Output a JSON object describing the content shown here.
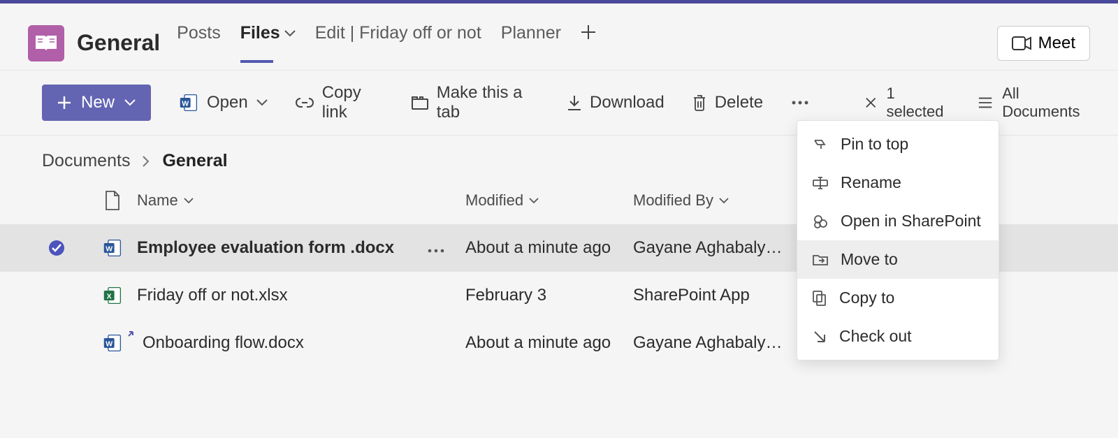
{
  "accent": "#5558af",
  "channel": {
    "name": "General",
    "tabs": {
      "posts": "Posts",
      "files": "Files",
      "edit": "Edit | Friday off or not",
      "planner": "Planner"
    },
    "meet_label": "Meet"
  },
  "commands": {
    "new": "New",
    "open": "Open",
    "copylink": "Copy link",
    "maketab": "Make this a tab",
    "download": "Download",
    "delete": "Delete",
    "selected": "1 selected",
    "view": "All Documents"
  },
  "breadcrumb": {
    "root": "Documents",
    "current": "General"
  },
  "columns": {
    "name": "Name",
    "modified": "Modified",
    "modifiedby": "Modified By"
  },
  "rows": [
    {
      "filetype": "word",
      "name": "Employee evaluation form .docx",
      "modified": "About a minute ago",
      "modifiedby": "Gayane Aghabaly…",
      "selected": true
    },
    {
      "filetype": "excel",
      "name": "Friday off or not.xlsx",
      "modified": "February 3",
      "modifiedby": "SharePoint App",
      "selected": false
    },
    {
      "filetype": "word",
      "name": "Onboarding flow.docx",
      "modified": "About a minute ago",
      "modifiedby": "Gayane Aghabaly…",
      "selected": false
    }
  ],
  "context_menu": {
    "pin": "Pin to top",
    "rename": "Rename",
    "sharepoint": "Open in SharePoint",
    "moveto": "Move to",
    "copyto": "Copy to",
    "checkout": "Check out"
  }
}
